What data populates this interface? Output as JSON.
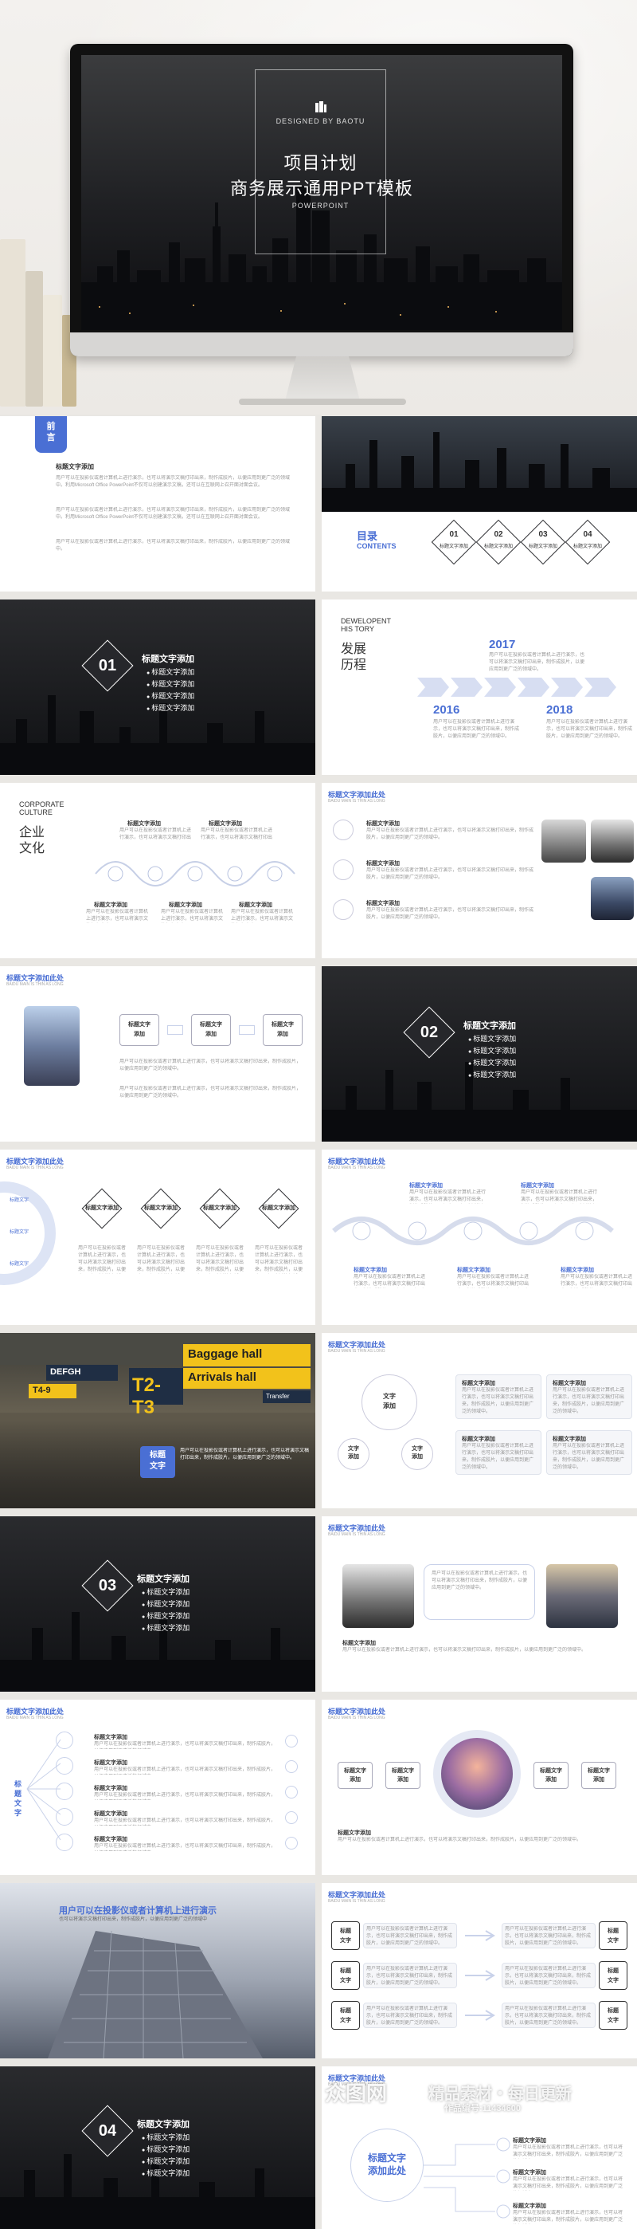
{
  "hero": {
    "designed_by": "DESIGNED BY BAOTU",
    "title_line1": "项目计划",
    "title_line2": "商务展示通用PPT模板",
    "subtitle": "POWERPOINT"
  },
  "slide_intro": {
    "tag_line1": "前",
    "tag_line2": "言",
    "heading": "标题文字添加",
    "para1": "用户可以在投影仪或者计算机上进行演示，也可以将演示文稿打印出来，制作成胶片，以便应用到更广泛的领域中。利用Microsoft Office PowerPoint不仅可以创建演示文稿，还可以在互联网上召开面对面会议。",
    "para2": "用户可以在投影仪或者计算机上进行演示，也可以将演示文稿打印出来，制作成胶片，以便应用到更广泛的领域中。利用Microsoft Office PowerPoint不仅可以创建演示文稿，还可以在互联网上召开面对面会议。",
    "para3": "用户可以在投影仪或者计算机上进行演示，也可以将演示文稿打印出来，制作成胶片，以便应用到更广泛的领域中。"
  },
  "slide_toc": {
    "title": "目录",
    "title_en": "CONTENTS",
    "items": [
      {
        "num": "01",
        "label": "标题文字添加"
      },
      {
        "num": "02",
        "label": "标题文字添加"
      },
      {
        "num": "03",
        "label": "标题文字添加"
      },
      {
        "num": "04",
        "label": "标题文字添加"
      }
    ]
  },
  "section01": {
    "num": "01",
    "title": "标题文字添加",
    "bullets": [
      "标题文字添加",
      "标题文字添加",
      "标题文字添加",
      "标题文字添加"
    ]
  },
  "history": {
    "en1": "DEWELOPENT",
    "en2": "HIS TORY",
    "cn1": "发展",
    "cn2": "历程",
    "years": [
      "2017",
      "2016",
      "2018"
    ],
    "desc": "用户可以在投影仪或者计算机上进行演示，也可以将演示文稿打印出来，制作成胶片，以便应用到更广泛的领域中。"
  },
  "culture": {
    "en1": "CORPORATE",
    "en2": "CULTURE",
    "cn1": "企业",
    "cn2": "文化",
    "label": "标题文字添加",
    "desc": "用户可以在投影仪或者计算机上进行演示，也可以将演示文稿打印出来。"
  },
  "generic": {
    "header": "标题文字添加此处",
    "header_sub": "BAIDU MAIN IS THIN AS LONG",
    "label": "标题文字添加",
    "label_short1": "标题文字",
    "label_short2": "添加",
    "desc": "用户可以在投影仪或者计算机上进行演示，也可以将演示文稿打印出来，制作成胶片，以便应用到更广泛的领域中。",
    "text_label": "文字",
    "text_add": "添加",
    "title_text": "标题",
    "title_text2": "文字",
    "title_text3": "标题",
    "title_text4": "文字"
  },
  "section02": {
    "num": "02",
    "title": "标题文字添加",
    "bullets": [
      "标题文字添加",
      "标题文字添加",
      "标题文字添加",
      "标题文字添加"
    ]
  },
  "section03": {
    "num": "03",
    "title": "标题文字添加",
    "bullets": [
      "标题文字添加",
      "标题文字添加",
      "标题文字添加",
      "标题文字添加"
    ]
  },
  "section04": {
    "num": "04",
    "title": "标题文字添加",
    "bullets": [
      "标题文字添加",
      "标题文字添加",
      "标题文字添加",
      "标题文字添加"
    ]
  },
  "airport": {
    "sign1": "Baggage hall",
    "sign2": "Arrivals hall",
    "sign3": "T2-T3",
    "sign4": "DEFGH",
    "sign5": "T4-9",
    "sign6": "Transfer",
    "badge1": "标题",
    "badge2": "文字"
  },
  "building": {
    "title": "用户可以在投影仪或者计算机上进行演示",
    "desc": "也可以将演示文稿打印出来，制作成胶片，以便应用到更广泛的领域中"
  },
  "last": {
    "title1": "标题文字",
    "title2": "添加此处"
  },
  "watermark": {
    "logo": "图网",
    "logo_prefix": "众",
    "text": "精品素材・每日更新",
    "id": "作品编号:11434600"
  }
}
